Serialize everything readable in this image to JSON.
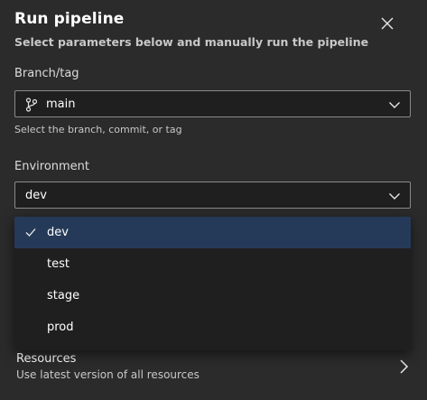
{
  "dialog": {
    "title": "Run pipeline",
    "subtitle": "Select parameters below and manually run the pipeline",
    "close_icon": "close-icon"
  },
  "branch": {
    "label": "Branch/tag",
    "value": "main",
    "icon": "git-branch-icon",
    "hint": "Select the branch, commit, or tag"
  },
  "environment": {
    "label": "Environment",
    "value": "dev",
    "options": [
      {
        "label": "dev",
        "selected": true
      },
      {
        "label": "test",
        "selected": false
      },
      {
        "label": "stage",
        "selected": false
      },
      {
        "label": "prod",
        "selected": false
      }
    ]
  },
  "resources": {
    "title": "Resources",
    "description": "Use latest version of all resources"
  },
  "colors": {
    "background": "#2b2b2b",
    "input_background": "#1f1f1f",
    "selected_option": "#253a59",
    "border": "#8a8a8a"
  }
}
